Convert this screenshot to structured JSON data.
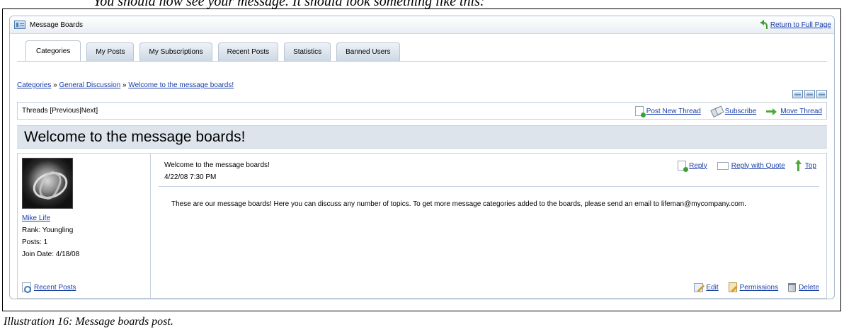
{
  "top_caption": "You should now see your message. It should look something like this:",
  "portlet": {
    "title": "Message Boards",
    "return_link": "Return to Full Page"
  },
  "tabs": [
    {
      "label": "Categories",
      "active": true
    },
    {
      "label": "My Posts",
      "active": false
    },
    {
      "label": "My Subscriptions",
      "active": false
    },
    {
      "label": "Recent Posts",
      "active": false
    },
    {
      "label": "Statistics",
      "active": false
    },
    {
      "label": "Banned Users",
      "active": false
    }
  ],
  "breadcrumb": {
    "items": [
      "Categories",
      "General Discussion",
      "Welcome to the message boards!"
    ],
    "separator": " » "
  },
  "thread_nav": {
    "prefix": "Threads [ ",
    "previous": "Previous",
    "divider": " | ",
    "next": "Next",
    "suffix": " ]"
  },
  "thread_actions": {
    "post_new_thread": "Post New Thread",
    "subscribe": "Subscribe",
    "move_thread": "Move Thread"
  },
  "thread_title": "Welcome to the message boards!",
  "post": {
    "user": {
      "name": "Mike Life",
      "rank": "Rank: Youngling",
      "posts": "Posts: 1",
      "join_date": "Join Date: 4/18/08",
      "recent_posts": "Recent Posts"
    },
    "subject": "Welcome to the message boards!",
    "date": "4/22/08 7:30 PM",
    "actions": {
      "reply": "Reply",
      "reply_with_quote": "Reply with Quote",
      "top": "Top"
    },
    "message": "These are our message boards! Here you can discuss any number of topics. To get more message categories added to the boards, please send an email to lifeman@mycompany.com.",
    "footer": {
      "edit": "Edit",
      "permissions": "Permissions",
      "delete": "Delete"
    }
  },
  "caption": "Illustration 16: Message boards post.",
  "colors": {
    "link": "#1a3ea8",
    "title_bar_bg": "#dde4ec",
    "border": "#c7d1dc"
  }
}
